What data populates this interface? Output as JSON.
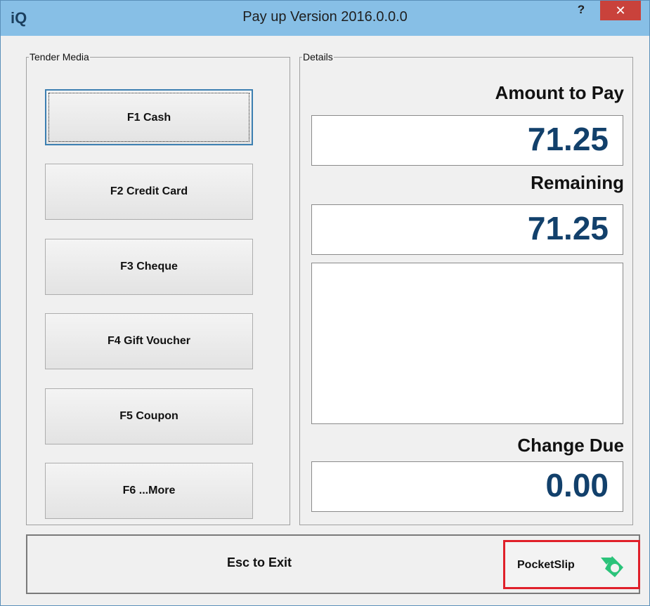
{
  "window": {
    "app_icon": "iQ",
    "title": "Pay up Version 2016.0.0.0",
    "help_label": "?",
    "close_label": "✕"
  },
  "tender_media": {
    "legend": "Tender Media",
    "buttons": [
      {
        "label": "F1 Cash",
        "focused": true
      },
      {
        "label": "F2 Credit Card"
      },
      {
        "label": "F3 Cheque"
      },
      {
        "label": "F4 Gift Voucher"
      },
      {
        "label": "F5 Coupon"
      },
      {
        "label": "F6 ...More"
      }
    ]
  },
  "details": {
    "legend": "Details",
    "amount_to_pay_label": "Amount to Pay",
    "amount_to_pay_value": "71.25",
    "remaining_label": "Remaining",
    "remaining_value": "71.25",
    "change_due_label": "Change Due",
    "change_due_value": "0.00"
  },
  "footer": {
    "exit_label": "Esc to Exit",
    "pocketslip_label": "PocketSlip",
    "pocketslip_icon": "pocketslip-logo-icon"
  },
  "colors": {
    "titlebar": "#87bfe6",
    "close": "#c9423b",
    "value_text": "#12406b",
    "highlight_border": "#e0202a",
    "logo_green": "#2bc37a"
  }
}
